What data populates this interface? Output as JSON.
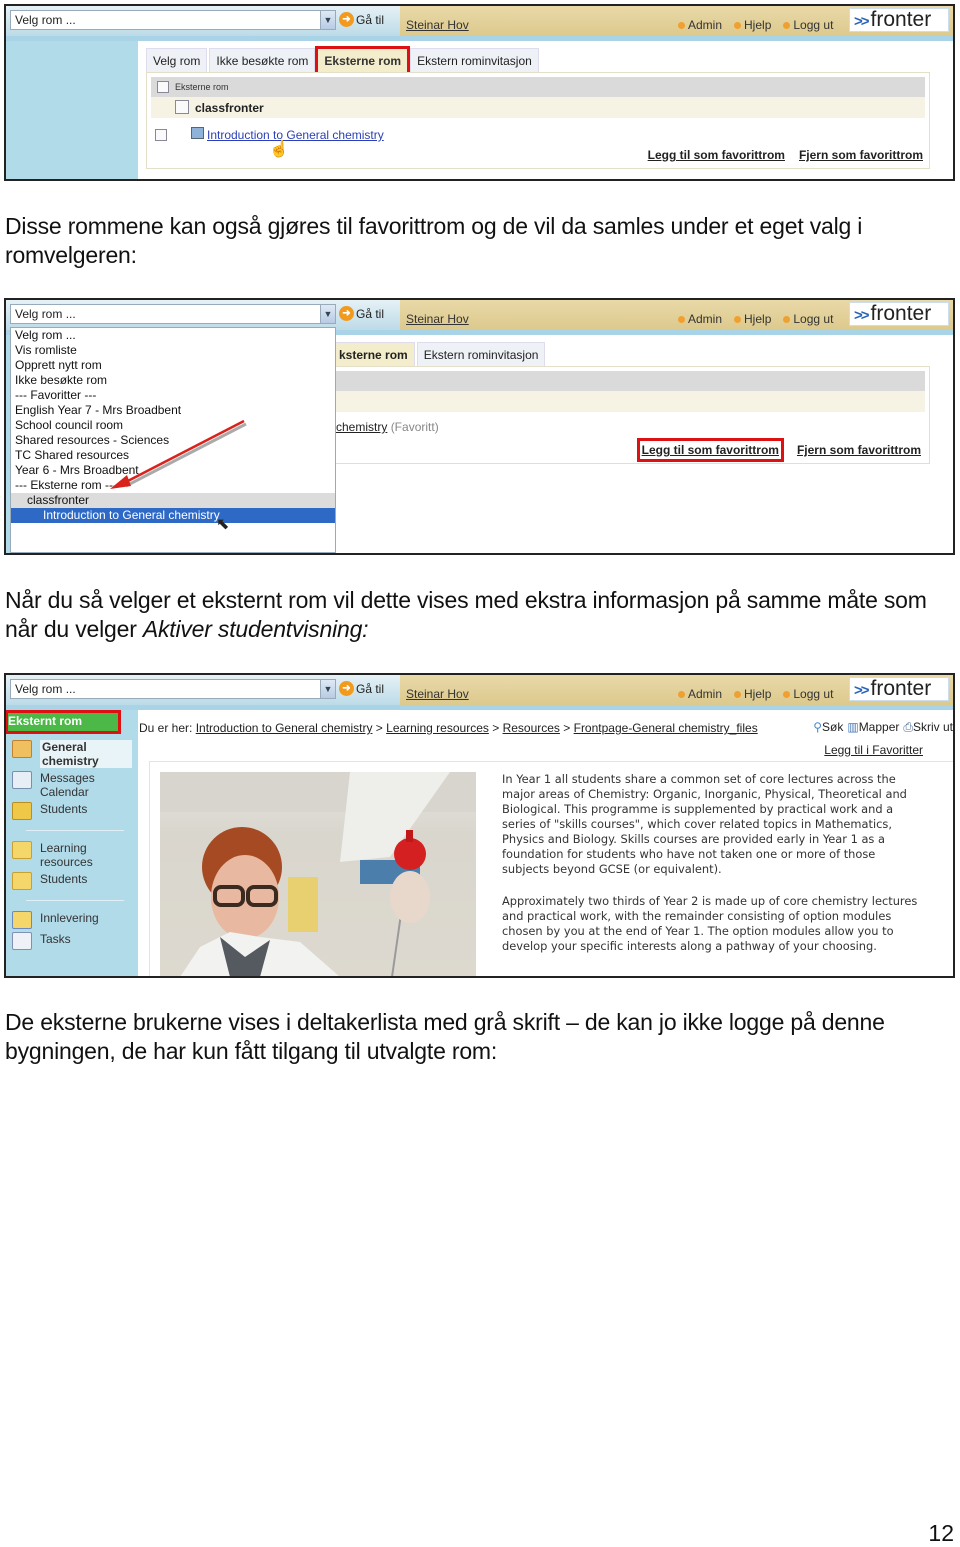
{
  "screenshot1": {
    "room_select": "Velg rom ...",
    "goto": "Gå til",
    "user": "Steinar Hov",
    "top_links": [
      "Admin",
      "Hjelp",
      "Logg ut"
    ],
    "logo": "fronter",
    "tabs": [
      "Velg rom",
      "Ikke besøkte rom",
      "Eksterne rom",
      "Ekstern rominvitasjon"
    ],
    "active_tab": "Eksterne rom",
    "table_header": "Eksterne rom",
    "group": "classfronter",
    "room": "Introduction to General chemistry",
    "add_favorite": "Legg til som favorittrom",
    "remove_favorite": "Fjern som favorittrom"
  },
  "paragraph1": "Disse rommene kan også gjøres til favorittrom og de vil da samles under et eget valg i romvelgeren:",
  "screenshot2": {
    "room_select": "Velg rom ...",
    "goto": "Gå til",
    "user": "Steinar Hov",
    "top_links": [
      "Admin",
      "Hjelp",
      "Logg ut"
    ],
    "logo": "fronter",
    "tabs": [
      "ksterne rom",
      "Ekstern rominvitasjon"
    ],
    "dropdown_options": [
      "Velg rom ...",
      "Vis romliste",
      "Opprett nytt rom",
      "Ikke besøkte rom",
      "--- Favoritter ---",
      "English Year 7 - Mrs Broadbent",
      "School council room",
      "Shared resources - Sciences",
      "TC Shared resources",
      "Year 6 - Mrs Broadbent",
      "--- Eksterne rom ---",
      "classfronter",
      "Introduction to General chemistry"
    ],
    "selected_option": "Introduction to General chemistry",
    "favorite_room_link": "chemistry",
    "favorite_tag": "(Favoritt)",
    "add_favorite": "Legg til som favorittrom",
    "remove_favorite": "Fjern som favorittrom"
  },
  "paragraph2": {
    "text": "Når du så velger et eksternt rom vil dette vises med ekstra informasjon på samme måte som når du velger ",
    "italic": "Aktiver studentvisning:"
  },
  "screenshot3": {
    "room_select": "Velg rom ...",
    "goto": "Gå til",
    "user": "Steinar Hov",
    "top_links": [
      "Admin",
      "Hjelp",
      "Logg ut"
    ],
    "logo": "fronter",
    "badge": "Eksternt rom",
    "sidebar": [
      {
        "label": "General chemistry",
        "icon": "room-icon",
        "bold": true
      },
      {
        "label": "Messages Calendar",
        "icon": "messages-icon"
      },
      {
        "label": "Students",
        "icon": "students-icon"
      },
      {
        "label": "Learning resources",
        "icon": "folder-icon"
      },
      {
        "label": "Students",
        "icon": "folder-icon"
      },
      {
        "label": "Innlevering",
        "icon": "handin-icon"
      },
      {
        "label": "Tasks",
        "icon": "tasks-icon"
      }
    ],
    "breadcrumb_prefix": "Du er her:",
    "breadcrumb": [
      "Introduction to General chemistry",
      "Learning resources",
      "Resources",
      "Frontpage-General chemistry_files"
    ],
    "tools": [
      "Søk",
      "Mapper",
      "Skriv ut"
    ],
    "add_to_favorites": "Legg til i Favoritter",
    "article": {
      "p1": "In Year 1 all students share a common set of core lectures across the major areas of Chemistry: Organic, Inorganic, Physical, Theoretical and Biological. This programme is supplemented by practical work and a series of \"skills courses\", which cover related topics in Mathematics, Physics and Biology. Skills courses are provided early in Year 1 as a foundation for students who have not taken one or more of those subjects beyond GCSE (or equivalent).",
      "p2": "Approximately two thirds of Year 2 is made up of core chemistry lectures and practical work, with the remainder consisting of option modules chosen by you at the end of Year 1. The option modules allow you to develop your specific interests along a pathway of your choosing."
    }
  },
  "paragraph3": "De eksterne brukerne vises i deltakerlista med grå skrift – de kan jo ikke logge på denne bygningen, de har kun fått tilgang til utvalgte rom:",
  "page_number": "12"
}
